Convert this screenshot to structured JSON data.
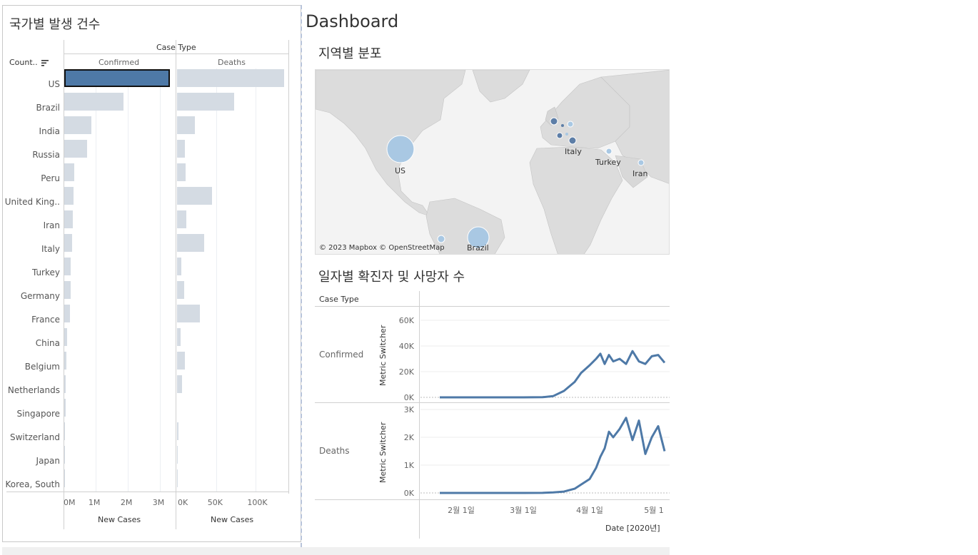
{
  "left_panel": {
    "title": "국가별 발생 건수",
    "header_case_type": "Case Type",
    "header_country": "Count..",
    "col_confirmed": "Confirmed",
    "col_deaths": "Deaths",
    "axis_title_confirmed": "New Cases",
    "axis_title_deaths": "New Cases",
    "ticks_confirmed": [
      "0M",
      "1M",
      "2M",
      "3M"
    ],
    "ticks_deaths": [
      "0K",
      "50K",
      "100K"
    ]
  },
  "countries": [
    {
      "name": "US",
      "confirmed": 3300000,
      "deaths": 135000,
      "selected": true
    },
    {
      "name": "Brazil",
      "confirmed": 1850000,
      "deaths": 72000
    },
    {
      "name": "India",
      "confirmed": 850000,
      "deaths": 22000
    },
    {
      "name": "Russia",
      "confirmed": 720000,
      "deaths": 10000
    },
    {
      "name": "Peru",
      "confirmed": 320000,
      "deaths": 11000
    },
    {
      "name": "United King..",
      "confirmed": 290000,
      "deaths": 44000
    },
    {
      "name": "Iran",
      "confirmed": 260000,
      "deaths": 12000
    },
    {
      "name": "Italy",
      "confirmed": 240000,
      "deaths": 34000
    },
    {
      "name": "Turkey",
      "confirmed": 210000,
      "deaths": 5000
    },
    {
      "name": "Germany",
      "confirmed": 195000,
      "deaths": 9000
    },
    {
      "name": "France",
      "confirmed": 170000,
      "deaths": 29000
    },
    {
      "name": "China",
      "confirmed": 84000,
      "deaths": 4600
    },
    {
      "name": "Belgium",
      "confirmed": 62000,
      "deaths": 9800
    },
    {
      "name": "Netherlands",
      "confirmed": 51000,
      "deaths": 6100
    },
    {
      "name": "Singapore",
      "confirmed": 45000,
      "deaths": 26
    },
    {
      "name": "Switzerland",
      "confirmed": 32000,
      "deaths": 1900
    },
    {
      "name": "Japan",
      "confirmed": 20000,
      "deaths": 980
    },
    {
      "name": "Korea, South",
      "confirmed": 13000,
      "deaths": 290
    }
  ],
  "dashboard": {
    "title": "Dashboard",
    "map_title": "지역별 분포",
    "map_copyright": "© 2023 Mapbox © OpenStreetMap",
    "map_labels": [
      "US",
      "Italy",
      "Turkey",
      "Iran",
      "Brazil"
    ],
    "line_title": "일자별 확진자 및 사망자 수",
    "line_case_type_header": "Case Type",
    "row_confirmed": "Confirmed",
    "row_deaths": "Deaths",
    "y_axis_title": "Metric Switcher",
    "x_axis_title": "Date [2020년]",
    "x_ticks": [
      "2월 1일",
      "3월 1일",
      "4월 1일",
      "5월 1"
    ],
    "confirmed_ticks": [
      "60K",
      "40K",
      "20K",
      "0K"
    ],
    "deaths_ticks": [
      "3K",
      "2K",
      "1K",
      "0K"
    ]
  },
  "colors": {
    "accent": "#4e79a7",
    "bar_light": "#d4dbe3",
    "bubble_light": "#a9c8e3",
    "bubble_dark": "#5d7ea7"
  },
  "chart_data": [
    {
      "type": "bar",
      "title": "국가별 발생 건수",
      "categories": [
        "US",
        "Brazil",
        "India",
        "Russia",
        "Peru",
        "United King..",
        "Iran",
        "Italy",
        "Turkey",
        "Germany",
        "France",
        "China",
        "Belgium",
        "Netherlands",
        "Singapore",
        "Switzerland",
        "Japan",
        "Korea, South"
      ],
      "series": [
        {
          "name": "Confirmed",
          "values": [
            3300000,
            1850000,
            850000,
            720000,
            320000,
            290000,
            260000,
            240000,
            210000,
            195000,
            170000,
            84000,
            62000,
            51000,
            45000,
            32000,
            20000,
            13000
          ]
        },
        {
          "name": "Deaths",
          "values": [
            135000,
            72000,
            22000,
            10000,
            11000,
            44000,
            12000,
            34000,
            5000,
            9000,
            29000,
            4600,
            9800,
            6100,
            26,
            1900,
            980,
            290
          ]
        }
      ],
      "xlabel": "New Cases"
    },
    {
      "type": "line",
      "title": "일자별 확진자 및 사망자 수",
      "x": [
        "2020-01-22",
        "2020-02-01",
        "2020-02-15",
        "2020-03-01",
        "2020-03-10",
        "2020-03-15",
        "2020-03-20",
        "2020-03-25",
        "2020-03-28",
        "2020-04-01",
        "2020-04-04",
        "2020-04-06",
        "2020-04-08",
        "2020-04-10",
        "2020-04-12",
        "2020-04-15",
        "2020-04-18",
        "2020-04-21",
        "2020-04-24",
        "2020-04-27",
        "2020-04-30",
        "2020-05-03",
        "2020-05-06"
      ],
      "series": [
        {
          "name": "Confirmed",
          "values": [
            0,
            0,
            0,
            0,
            100,
            1000,
            5000,
            12000,
            19000,
            25000,
            30000,
            34000,
            26000,
            33000,
            28000,
            30000,
            26000,
            36000,
            28000,
            26000,
            32000,
            33000,
            27000
          ]
        },
        {
          "name": "Deaths",
          "values": [
            0,
            0,
            0,
            0,
            2,
            20,
            50,
            150,
            300,
            500,
            900,
            1300,
            1600,
            2200,
            2000,
            2300,
            2700,
            1900,
            2600,
            1400,
            2000,
            2400,
            1500
          ]
        }
      ],
      "xlabel": "Date [2020년]",
      "ylabel": "Metric Switcher"
    }
  ]
}
